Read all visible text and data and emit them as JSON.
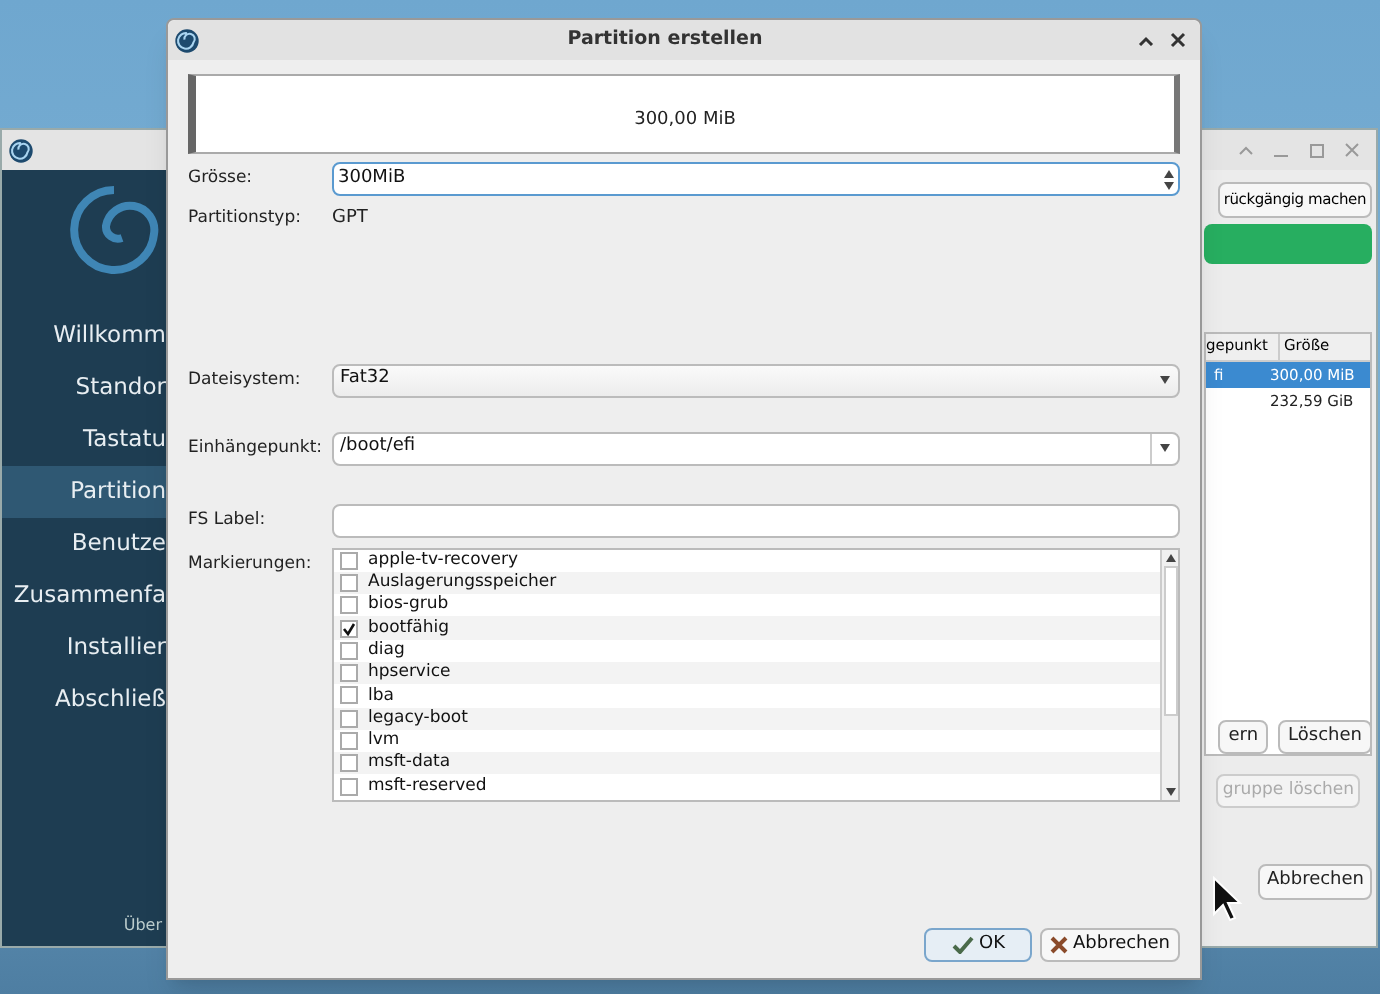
{
  "background_window": {
    "sidebar": {
      "items": [
        {
          "label": "Willkomm",
          "selected": false
        },
        {
          "label": "Standor",
          "selected": false
        },
        {
          "label": "Tastatu",
          "selected": false
        },
        {
          "label": "Partition",
          "selected": true
        },
        {
          "label": "Benutze",
          "selected": false
        },
        {
          "label": "Zusammenfa",
          "selected": false
        },
        {
          "label": "Installier",
          "selected": false
        },
        {
          "label": "Abschließ",
          "selected": false
        }
      ],
      "footer": "Über"
    },
    "undo_button": "rückgängig machen",
    "table": {
      "columns": [
        "gepunkt",
        "Größe"
      ],
      "rows": [
        {
          "cells": [
            "fi",
            "300,00 MiB"
          ],
          "selected": true
        },
        {
          "cells": [
            "",
            "232,59 GiB"
          ],
          "selected": false
        }
      ]
    },
    "buttons": [
      {
        "label": "ern",
        "disabled": false
      },
      {
        "label": "Löschen",
        "disabled": false
      }
    ],
    "delete_group_button": {
      "label": "gruppe löschen",
      "disabled": true
    },
    "cancel_button": "Abbrechen"
  },
  "dialog": {
    "title": "Partition erstellen",
    "preview": "300,00 MiB",
    "size": {
      "label": "Grösse:",
      "value": "300MiB"
    },
    "partition_type": {
      "label": "Partitionstyp:",
      "value": "GPT"
    },
    "filesystem": {
      "label": "Dateisystem:",
      "value": "Fat32"
    },
    "mount_point": {
      "label": "Einhängepunkt:",
      "value": "/boot/efi"
    },
    "fs_label": {
      "label": "FS Label:"
    },
    "flags": {
      "label": "Markierungen:",
      "items": [
        {
          "label": "apple-tv-recovery",
          "checked": false
        },
        {
          "label": "Auslagerungsspeicher",
          "checked": false
        },
        {
          "label": "bios-grub",
          "checked": false
        },
        {
          "label": "bootfähig",
          "checked": true
        },
        {
          "label": "diag",
          "checked": false
        },
        {
          "label": "hpservice",
          "checked": false
        },
        {
          "label": "lba",
          "checked": false
        },
        {
          "label": "legacy-boot",
          "checked": false
        },
        {
          "label": "lvm",
          "checked": false
        },
        {
          "label": "msft-data",
          "checked": false
        },
        {
          "label": "msft-reserved",
          "checked": false
        }
      ]
    },
    "buttons": [
      "OK",
      "Abbrechen"
    ]
  }
}
